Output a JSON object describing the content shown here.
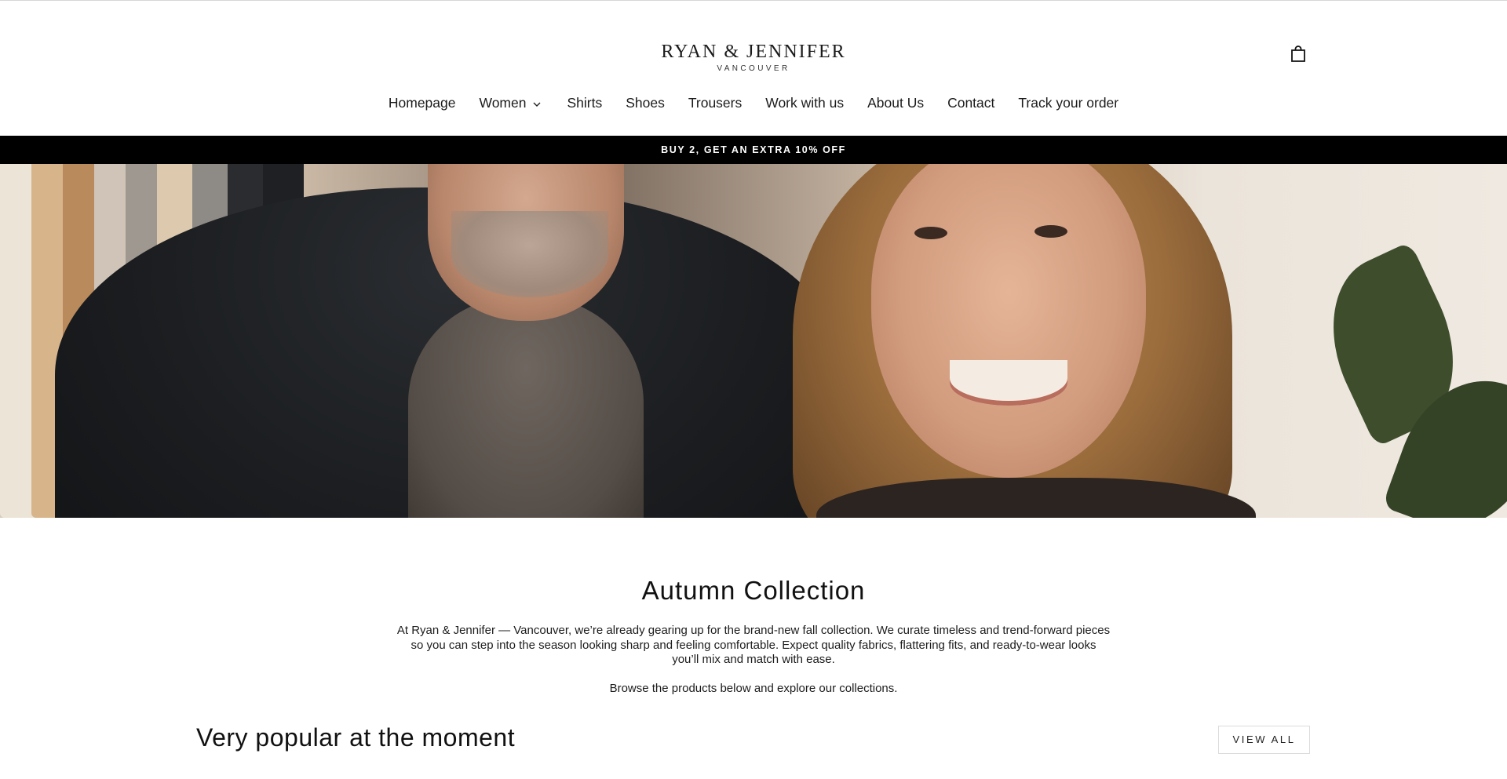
{
  "brand": {
    "name": "RYAN & JENNIFER",
    "location": "VANCOUVER"
  },
  "nav": {
    "items": [
      {
        "label": "Homepage"
      },
      {
        "label": "Women",
        "has_dropdown": true
      },
      {
        "label": "Shirts"
      },
      {
        "label": "Shoes"
      },
      {
        "label": "Trousers"
      },
      {
        "label": "Work with us"
      },
      {
        "label": "About Us"
      },
      {
        "label": "Contact"
      },
      {
        "label": "Track your order"
      }
    ]
  },
  "header": {
    "cart_icon": "shopping-bag-icon"
  },
  "announcement": {
    "text": "BUY 2, GET AN EXTRA 10% OFF"
  },
  "hero": {
    "image": "couple-portrait-banner"
  },
  "intro": {
    "title": "Autumn Collection",
    "text": "At Ryan & Jennifer — Vancouver, we’re already gearing up for the brand-new fall collection. We curate timeless and trend-forward pieces so you can step into the season looking sharp and feeling comfortable. Expect quality fabrics, flattering fits, and ready-to-wear looks you’ll mix and match with ease.",
    "browse": "Browse the products below and explore our collections."
  },
  "featured": {
    "title": "Very popular at the moment",
    "view_all_label": "VIEW ALL"
  },
  "colors": {
    "announcement_bg": "#000000",
    "announcement_text": "#ffffff",
    "text": "#111111"
  }
}
